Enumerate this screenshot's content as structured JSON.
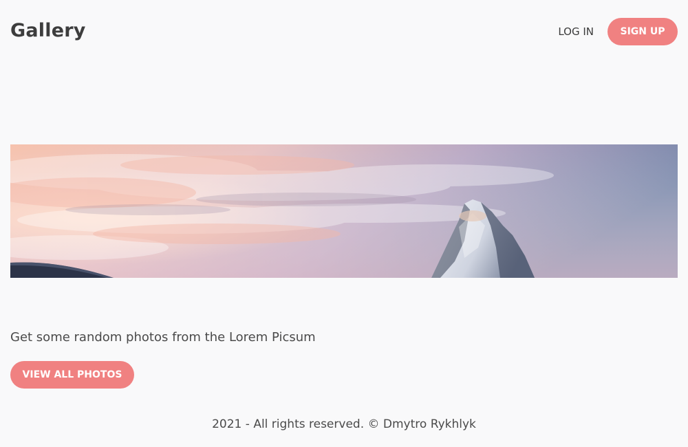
{
  "header": {
    "logo": "Gallery",
    "login_label": "LOG IN",
    "signup_label": "SIGN UP"
  },
  "hero": {
    "image": "mountain-peak-sunset-photo"
  },
  "main": {
    "tagline": "Get some random photos from the Lorem Picsum",
    "view_all_label": "VIEW ALL PHOTOS"
  },
  "footer": {
    "text": "2021 - All rights reserved. © Dmytro Rykhlyk"
  },
  "colors": {
    "background": "#f9f9fa",
    "accent": "#f08181",
    "text": "#444444"
  }
}
